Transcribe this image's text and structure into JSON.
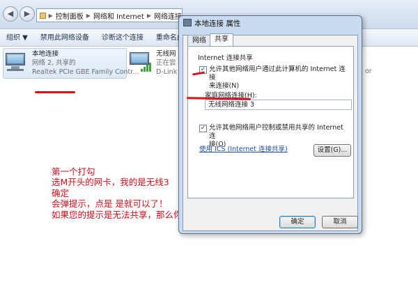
{
  "address_bar": {
    "breadcrumbs": [
      "控制面板",
      "网络和 Internet",
      "网络连接"
    ]
  },
  "toolbar": {
    "items": [
      "组织 ▼",
      "禁用此网络设备",
      "诊断这个连接",
      "重命名此连"
    ]
  },
  "connections": [
    {
      "name": "本地连接",
      "status": "网络 2, 共享的",
      "adapter": "Realtek PCIe GBE Family Contr..."
    },
    {
      "name": "无线网",
      "status": "正在尝",
      "adapter": "D-Link",
      "tail": "or"
    }
  ],
  "dialog": {
    "title": "本地连接 属性",
    "tabs": [
      "网络",
      "共享"
    ],
    "active_tab": "共享",
    "group_label": "Internet 连接共享",
    "allow_share_line1": "允许其他网络用户通过此计算机的 Internet 连接",
    "allow_share_line2": "来连接(N)",
    "allow_share_checked": true,
    "home_network_label": "家庭网络连接(H):",
    "home_network_value": "无线网络连接 3",
    "allow_control_line1": "允许其他网络用户控制或禁用共享的 Internet 连",
    "allow_control_line2": "接(O)",
    "allow_control_checked": true,
    "ics_link": "使用 ICS (Internet 连接共享)",
    "settings_button": "设置(G)...",
    "ok_button": "确定",
    "cancel_button": "取消"
  },
  "annotation": {
    "lines": [
      "第一个打勾",
      "选M开头的网卡，我的是无线3",
      "确定",
      "会弹提示，点是 是就可以了！",
      "如果您的提示是无法共享，那么你的网络就是受限制的，无法使用WIFI共享精灵："
    ]
  },
  "colors": {
    "annotation_red": "#d40f1d",
    "link_blue": "#1a4fa3",
    "dialog_frame": "#c9dbf0"
  }
}
